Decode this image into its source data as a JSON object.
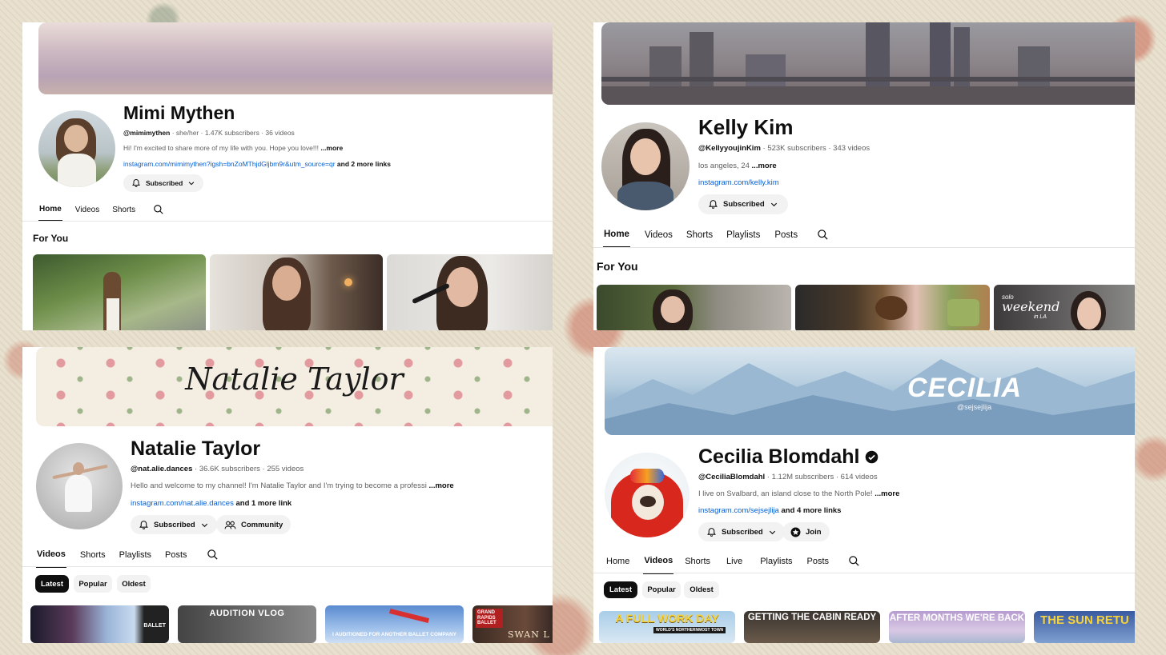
{
  "panels": {
    "mimi": {
      "name": "Mimi Mythen",
      "handle": "@mimimythen",
      "stats": " · she/her · 1.47K subscribers · 36 videos",
      "description": "Hi! I'm excited to share more of my life with you. Hope you love!!! ",
      "more": "...more",
      "link": "instagram.com/mimimythen?igsh=bnZoMThjdGljbm9r&utm_source=qr",
      "link_extra": " and 2 more links",
      "subscribe": "Subscribed",
      "tabs": [
        "Home",
        "Videos",
        "Shorts"
      ],
      "section": "For You"
    },
    "kelly": {
      "name": "Kelly Kim",
      "handle": "@KellyyoujinKim",
      "stats": " · 523K subscribers · 343 videos",
      "description": "los angeles, 24 ",
      "more": "...more",
      "link": "instagram.com/kelly.kim",
      "subscribe": "Subscribed",
      "tabs": [
        "Home",
        "Videos",
        "Shorts",
        "Playlists",
        "Posts"
      ],
      "section": "For You",
      "thumb_text": [
        "solo",
        "weekend",
        "in LA"
      ]
    },
    "natalie": {
      "name": "Natalie Taylor",
      "banner_text": "Natalie Taylor",
      "handle": "@nat.alie.dances",
      "stats": " · 36.6K subscribers · 255 videos",
      "description": "Hello and welcome to my channel! I'm Natalie Taylor and I'm trying to become a professi",
      "more": "...more",
      "link": "instagram.com/nat.alie.dances",
      "link_extra": " and 1 more link",
      "subscribe": "Subscribed",
      "community": "Community",
      "tabs": [
        "Videos",
        "Shorts",
        "Playlists",
        "Posts"
      ],
      "chips": [
        "Latest",
        "Popular",
        "Oldest"
      ],
      "thumb_texts": [
        "BALLET",
        "AUDITION VLOG",
        "I AUDITIONED FOR ANOTHER BALLET COMPANY",
        "GRAND RAPIDS BALLET",
        "SWAN L"
      ]
    },
    "cecilia": {
      "name": "Cecilia Blomdahl",
      "banner_text": "CECILIA",
      "banner_handle": "@sejsejlija",
      "handle": "@CeciliaBlomdahl",
      "stats": " · 1.12M subscribers · 614 videos",
      "description": "I live on Svalbard, an island close to the North Pole! ",
      "more": "...more",
      "link": "instagram.com/sejsejlija",
      "link_extra": " and 4 more links",
      "subscribe": "Subscribed",
      "join": "Join",
      "tabs": [
        "Home",
        "Videos",
        "Shorts",
        "Live",
        "Playlists",
        "Posts"
      ],
      "chips": [
        "Latest",
        "Popular",
        "Oldest"
      ],
      "thumb_texts": [
        "A FULL WORK DAY",
        "WORLD'S NORTHERNMOST TOWN",
        "GETTING THE CABIN READY",
        "AFTER MONTHS WE'RE BACK",
        "THE SUN RETU"
      ]
    }
  }
}
